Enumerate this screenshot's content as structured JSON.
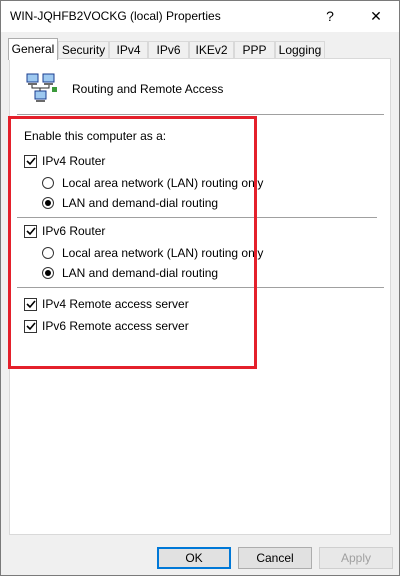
{
  "window": {
    "title": "WIN-JQHFB2VOCKG (local) Properties",
    "help_glyph": "?",
    "close_glyph": "✕"
  },
  "tabs": [
    {
      "label": "General",
      "active": true
    },
    {
      "label": "Security"
    },
    {
      "label": "IPv4"
    },
    {
      "label": "IPv6"
    },
    {
      "label": "IKEv2"
    },
    {
      "label": "PPP"
    },
    {
      "label": "Logging"
    }
  ],
  "general": {
    "icon": "routing-computers-icon",
    "app_name": "Routing and Remote Access",
    "group_label": "Enable this computer as a:",
    "ipv4_router": {
      "label": "IPv4 Router",
      "checked": true
    },
    "ipv4_lan_only": {
      "label": "Local area network (LAN) routing only",
      "selected": false
    },
    "ipv4_lan_demand": {
      "label": "LAN and demand-dial routing",
      "selected": true
    },
    "ipv6_router": {
      "label": "IPv6 Router",
      "checked": true
    },
    "ipv6_lan_only": {
      "label": "Local area network (LAN) routing only",
      "selected": false
    },
    "ipv6_lan_demand": {
      "label": "LAN and demand-dial routing",
      "selected": true
    },
    "ipv4_ras": {
      "label": "IPv4 Remote access server",
      "checked": true
    },
    "ipv6_ras": {
      "label": "IPv6 Remote access server",
      "checked": true
    }
  },
  "buttons": {
    "ok": "OK",
    "cancel": "Cancel",
    "apply": "Apply"
  },
  "colors": {
    "highlight_border": "#e4202b",
    "default_button_border": "#0078d7"
  }
}
